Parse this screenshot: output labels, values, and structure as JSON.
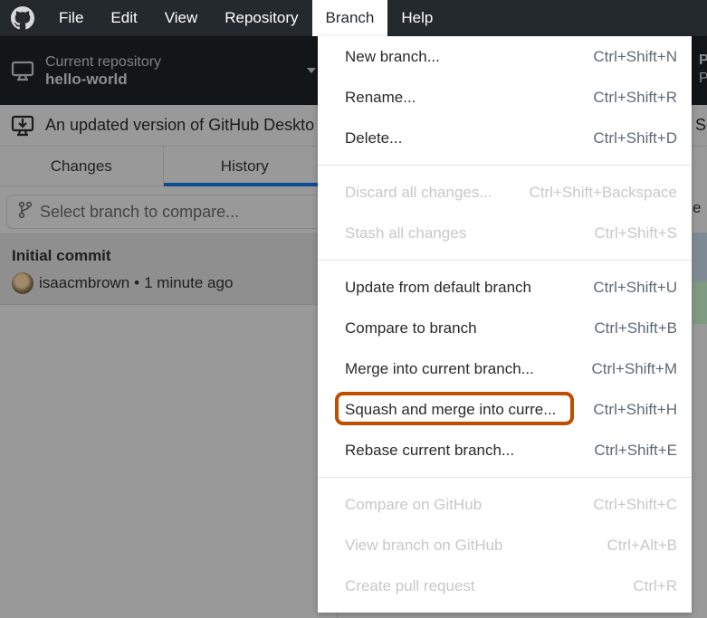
{
  "menubar": {
    "items": [
      {
        "label": "File"
      },
      {
        "label": "Edit"
      },
      {
        "label": "View"
      },
      {
        "label": "Repository"
      },
      {
        "label": "Branch",
        "active": true
      },
      {
        "label": "Help"
      }
    ]
  },
  "toolbar": {
    "repo_label": "Current repository",
    "repo_name": "hello-world",
    "right_fragment_1": "P",
    "right_fragment_2": "P"
  },
  "banner": {
    "text": "An updated version of GitHub Deskto",
    "right_fragment": "Se"
  },
  "sidebar": {
    "tabs": [
      {
        "label": "Changes",
        "selected": false
      },
      {
        "label": "History",
        "selected": true
      }
    ],
    "compare_placeholder": "Select branch to compare...",
    "commits": [
      {
        "title": "Initial commit",
        "author": "isaacmbrown",
        "time": "1 minute ago",
        "separator": "•"
      }
    ]
  },
  "right_panel": {
    "fragment": "e"
  },
  "branch_menu": {
    "groups": [
      [
        {
          "label": "New branch...",
          "accel": "Ctrl+Shift+N",
          "enabled": true
        },
        {
          "label": "Rename...",
          "accel": "Ctrl+Shift+R",
          "enabled": true
        },
        {
          "label": "Delete...",
          "accel": "Ctrl+Shift+D",
          "enabled": true
        }
      ],
      [
        {
          "label": "Discard all changes...",
          "accel": "Ctrl+Shift+Backspace",
          "enabled": false
        },
        {
          "label": "Stash all changes",
          "accel": "Ctrl+Shift+S",
          "enabled": false
        }
      ],
      [
        {
          "label": "Update from default branch",
          "accel": "Ctrl+Shift+U",
          "enabled": true
        },
        {
          "label": "Compare to branch",
          "accel": "Ctrl+Shift+B",
          "enabled": true
        },
        {
          "label": "Merge into current branch...",
          "accel": "Ctrl+Shift+M",
          "enabled": true
        },
        {
          "label": "Squash and merge into curre...",
          "accel": "Ctrl+Shift+H",
          "enabled": true,
          "highlighted": true
        },
        {
          "label": "Rebase current branch...",
          "accel": "Ctrl+Shift+E",
          "enabled": true
        }
      ],
      [
        {
          "label": "Compare on GitHub",
          "accel": "Ctrl+Shift+C",
          "enabled": false
        },
        {
          "label": "View branch on GitHub",
          "accel": "Ctrl+Alt+B",
          "enabled": false
        },
        {
          "label": "Create pull request",
          "accel": "Ctrl+R",
          "enabled": false
        }
      ]
    ],
    "highlight_color": "#bf4e00"
  }
}
